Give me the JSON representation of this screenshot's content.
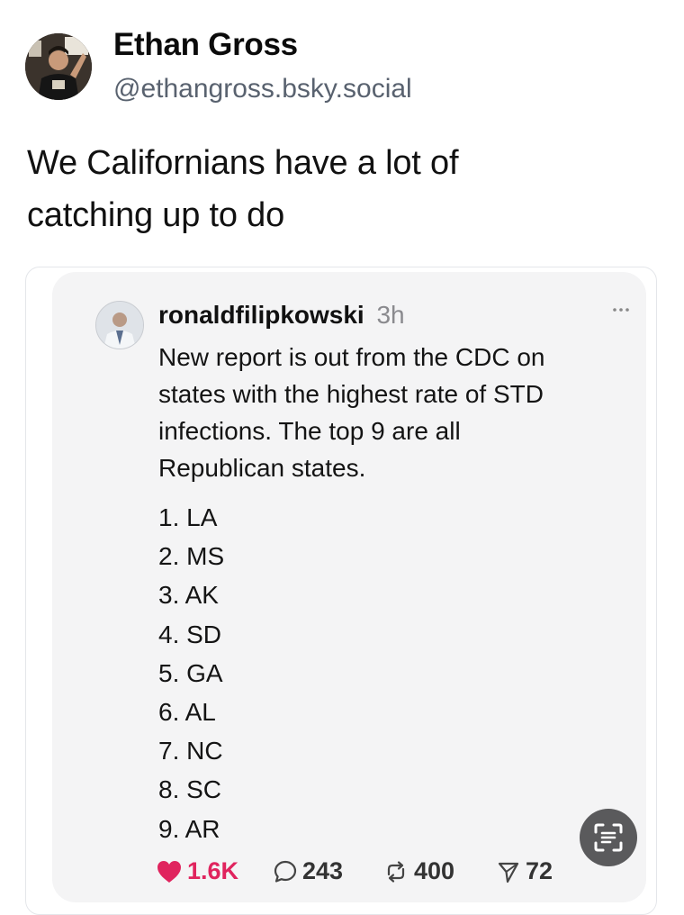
{
  "author": {
    "name": "Ethan Gross",
    "handle": "@ethangross.bsky.social"
  },
  "post": {
    "line1": "We Californians have a lot of",
    "line2": "catching up to do"
  },
  "embedded_post": {
    "username": "ronaldfilipkowski",
    "time": "3h",
    "text_lines": [
      "New report is out from the CDC on",
      "states with the highest rate of STD",
      "infections. The top 9 are all",
      "Republican states."
    ],
    "states": [
      "1. LA",
      "2. MS",
      "3. AK",
      "4. SD",
      "5. GA",
      "6. AL",
      "7. NC",
      "8. SC",
      "9. AR"
    ],
    "stats": {
      "likes": "1.6K",
      "comments": "243",
      "reposts": "400",
      "shares": "72"
    },
    "like_color": "#e0245e"
  },
  "icons": [
    "heart-icon",
    "comment-icon",
    "repost-icon",
    "share-icon",
    "more-icon",
    "scan-text-icon"
  ]
}
